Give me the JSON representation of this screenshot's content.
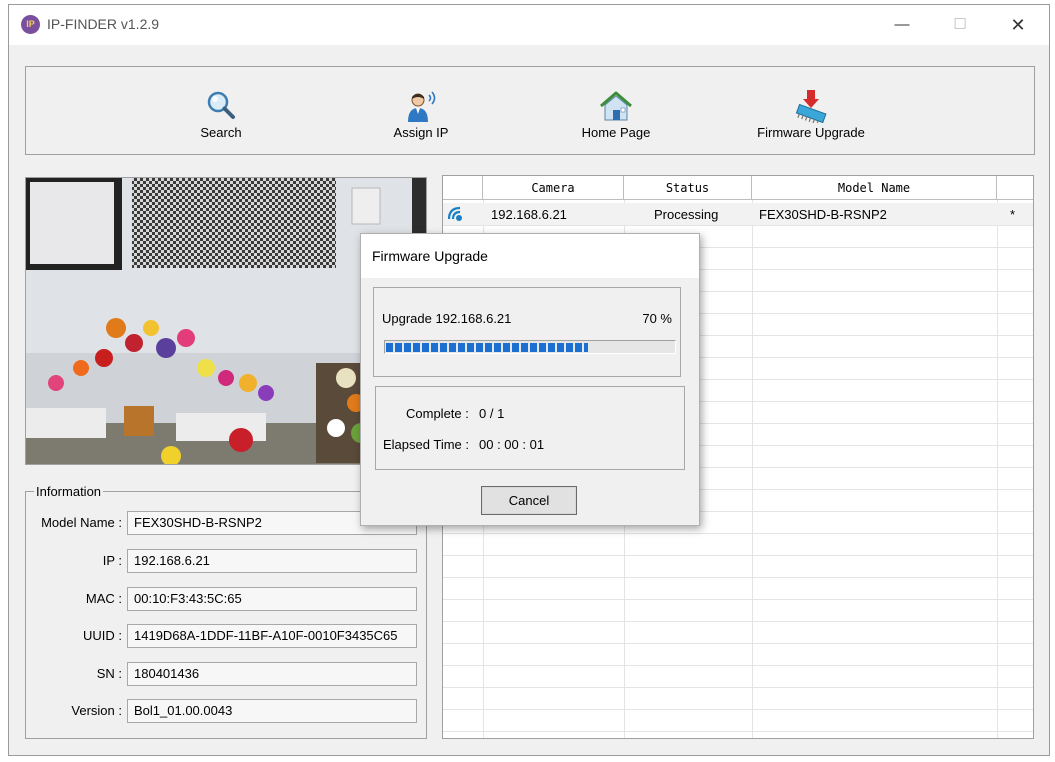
{
  "app": {
    "title": "IP-FINDER v1.2.9",
    "icon_text": "IP"
  },
  "window_controls": {
    "minimize": "—",
    "maximize": "☐",
    "close": "✕"
  },
  "toolbar": {
    "search": "Search",
    "assign_ip": "Assign IP",
    "home_page": "Home Page",
    "firmware_upgrade": "Firmware Upgrade"
  },
  "information": {
    "legend": "Information",
    "fields": [
      {
        "label": "Model Name :",
        "value": "FEX30SHD-B-RSNP2"
      },
      {
        "label": "IP :",
        "value": "192.168.6.21"
      },
      {
        "label": "MAC :",
        "value": "00:10:F3:43:5C:65"
      },
      {
        "label": "UUID :",
        "value": "1419D68A-1DDF-11BF-A10F-0010F3435C65"
      },
      {
        "label": "SN :",
        "value": "180401436"
      },
      {
        "label": "Version :",
        "value": "Bol1_01.00.0043"
      }
    ]
  },
  "device_list": {
    "headers": {
      "camera": "Camera",
      "status": "Status",
      "model": "Model Name"
    },
    "rows": [
      {
        "camera": "192.168.6.21",
        "status": "Processing",
        "model": "FEX30SHD-B-RSNP2",
        "mark": "*"
      }
    ]
  },
  "dialog": {
    "title": "Firmware Upgrade",
    "upgrade_text": "Upgrade 192.168.6.21",
    "percent_text": "70 %",
    "progress": 0.7,
    "complete_label": "Complete :",
    "complete_value": "0 / 1",
    "elapsed_label": "Elapsed Time :",
    "elapsed_value": "00 : 00 : 01",
    "cancel": "Cancel"
  },
  "colors": {
    "progress": "#1a6fd1",
    "accent_purple": "#7b4fa0"
  }
}
